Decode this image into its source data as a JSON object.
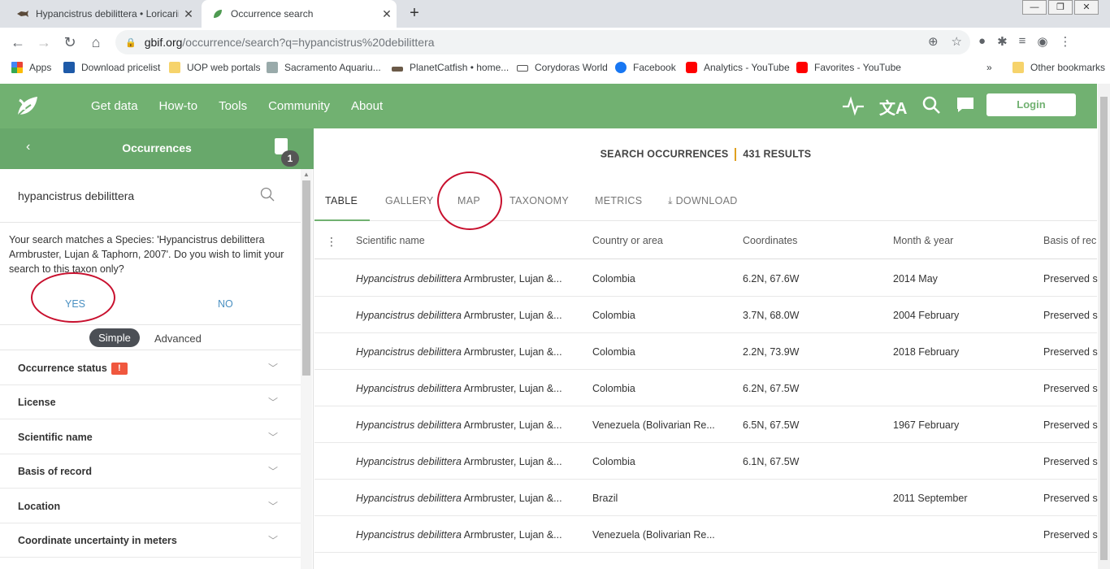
{
  "browser": {
    "tabs": [
      {
        "title": "Hypancistrus debilittera • Loricariidae",
        "active": false
      },
      {
        "title": "Occurrence search",
        "active": true
      }
    ],
    "url_domain": "gbif.org",
    "url_path": "/occurrence/search?q=hypancistrus%20debilittera",
    "bookmarks": [
      "Apps",
      "Download pricelist",
      "UOP web portals",
      "Sacramento Aquariu...",
      "PlanetCatfish • home...",
      "Corydoras World",
      "Facebook",
      "Analytics - YouTube",
      "Favorites - YouTube"
    ],
    "other_bookmarks": "Other bookmarks",
    "overflow": "»"
  },
  "header": {
    "nav": [
      "Get data",
      "How-to",
      "Tools",
      "Community",
      "About"
    ],
    "login": "Login"
  },
  "sidebar": {
    "back": "‹",
    "title": "Occurrences",
    "badge": "1",
    "search_value": "hypancistrus debilittera",
    "suggestion": "Your search matches a Species: 'Hypancistrus debilittera Armbruster, Lujan & Taphorn, 2007'. Do you wish to limit your search to this taxon only?",
    "yes": "YES",
    "no": "NO",
    "mode_simple": "Simple",
    "mode_advanced": "Advanced",
    "warn": "!",
    "filters": [
      "Occurrence status",
      "License",
      "Scientific name",
      "Basis of record",
      "Location",
      "Coordinate uncertainty in meters"
    ]
  },
  "main": {
    "search_label": "SEARCH OCCURRENCES",
    "results": "431 RESULTS",
    "tabs": [
      "TABLE",
      "GALLERY",
      "MAP",
      "TAXONOMY",
      "METRICS",
      "DOWNLOAD"
    ],
    "columns": [
      "Scientific name",
      "Country or area",
      "Coordinates",
      "Month & year",
      "Basis of rec"
    ],
    "rows": [
      {
        "genus_species": "Hypancistrus debilittera",
        "author": " Armbruster, Lujan &...",
        "country": "Colombia",
        "coords": "6.2N, 67.6W",
        "date": "2014 May",
        "basis": "Preserved s"
      },
      {
        "genus_species": "Hypancistrus debilittera",
        "author": " Armbruster, Lujan &...",
        "country": "Colombia",
        "coords": "3.7N, 68.0W",
        "date": "2004 February",
        "basis": "Preserved s"
      },
      {
        "genus_species": "Hypancistrus debilittera",
        "author": " Armbruster, Lujan &...",
        "country": "Colombia",
        "coords": "2.2N, 73.9W",
        "date": "2018 February",
        "basis": "Preserved s"
      },
      {
        "genus_species": "Hypancistrus debilittera",
        "author": " Armbruster, Lujan &...",
        "country": "Colombia",
        "coords": "6.2N, 67.5W",
        "date": "",
        "basis": "Preserved s"
      },
      {
        "genus_species": "Hypancistrus debilittera",
        "author": " Armbruster, Lujan &...",
        "country": "Venezuela (Bolivarian Re...",
        "coords": "6.5N, 67.5W",
        "date": "1967 February",
        "basis": "Preserved s"
      },
      {
        "genus_species": "Hypancistrus debilittera",
        "author": " Armbruster, Lujan &...",
        "country": "Colombia",
        "coords": "6.1N, 67.5W",
        "date": "",
        "basis": "Preserved s"
      },
      {
        "genus_species": "Hypancistrus debilittera",
        "author": " Armbruster, Lujan &...",
        "country": "Brazil",
        "coords": "",
        "date": "2011 September",
        "basis": "Preserved s"
      },
      {
        "genus_species": "Hypancistrus debilittera",
        "author": " Armbruster, Lujan &...",
        "country": "Venezuela (Bolivarian Re...",
        "coords": "",
        "date": "",
        "basis": "Preserved s"
      }
    ]
  }
}
